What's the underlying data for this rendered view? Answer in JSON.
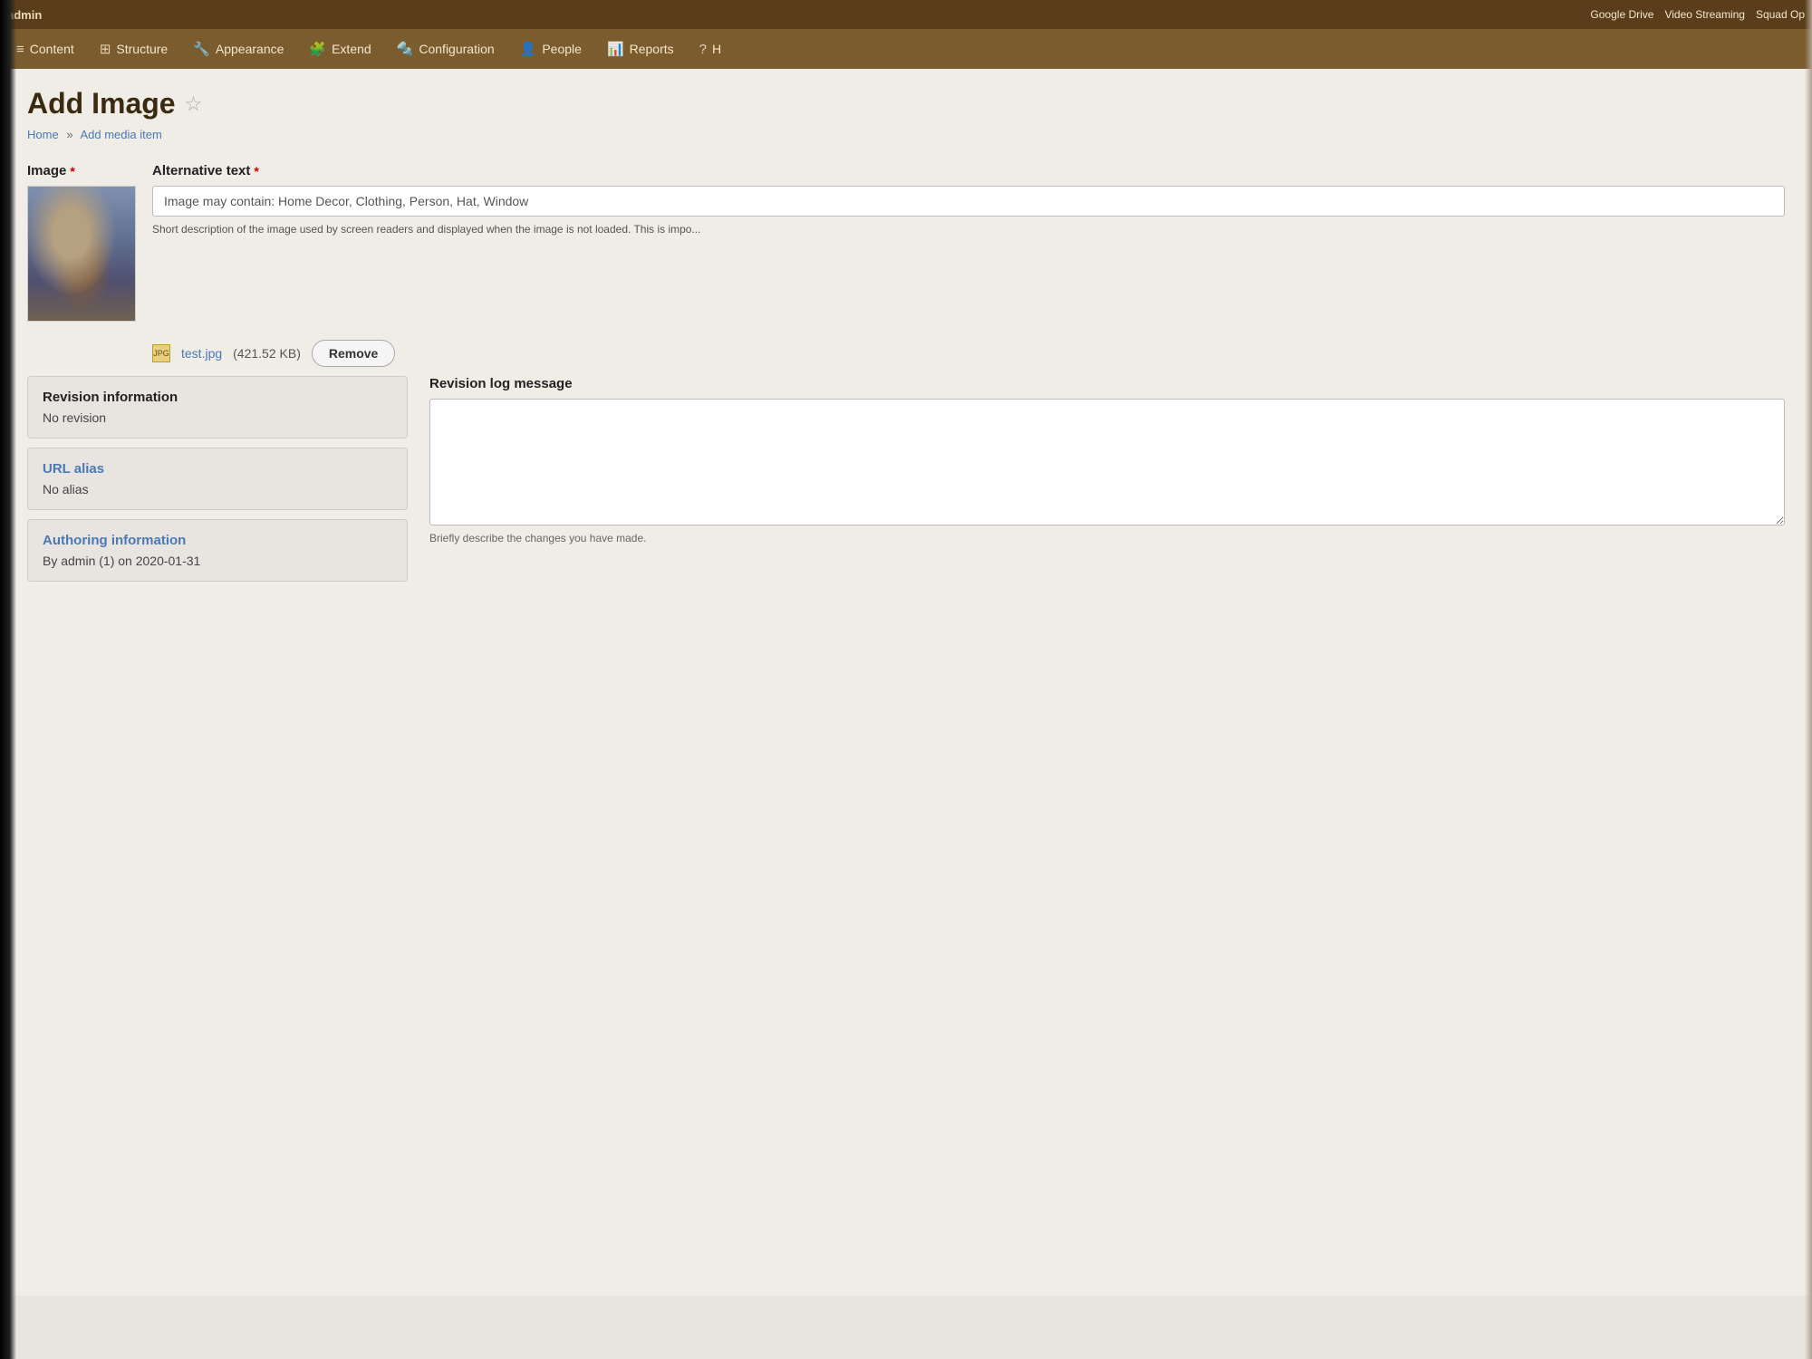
{
  "admin_bar": {
    "user_label": "admin",
    "google_drive": "Google Drive",
    "video_streaming": "Video Streaming",
    "squad_op": "Squad Op"
  },
  "nav": {
    "items": [
      {
        "id": "content",
        "label": "Content",
        "icon": "≡"
      },
      {
        "id": "structure",
        "label": "Structure",
        "icon": "⊞"
      },
      {
        "id": "appearance",
        "label": "Appearance",
        "icon": "🔧"
      },
      {
        "id": "extend",
        "label": "Extend",
        "icon": "🧩"
      },
      {
        "id": "configuration",
        "label": "Configuration",
        "icon": "🔩"
      },
      {
        "id": "people",
        "label": "People",
        "icon": "👤"
      },
      {
        "id": "reports",
        "label": "Reports",
        "icon": "📊"
      },
      {
        "id": "help",
        "label": "H",
        "icon": "?"
      }
    ]
  },
  "page": {
    "title": "Add Image",
    "breadcrumb_home": "Home",
    "breadcrumb_sep": "»",
    "breadcrumb_current": "Add media item"
  },
  "image_field": {
    "label": "Image",
    "required": true
  },
  "alt_text": {
    "label": "Alternative text",
    "required": true,
    "value": "Image may contain: Home Decor, Clothing, Person, Hat, Window",
    "hint": "Short description of the image used by screen readers and displayed when the image is not loaded. This is impo..."
  },
  "file_info": {
    "icon_label": "JPG",
    "filename": "test.jpg",
    "size": "(421.52 KB)",
    "remove_btn": "Remove"
  },
  "revision_info": {
    "box_title": "Revision information",
    "box_value": "No revision",
    "url_alias_title": "URL alias",
    "url_alias_value": "No alias",
    "authoring_title": "Authoring information",
    "authoring_value": "By admin (1) on 2020-01-31"
  },
  "revision_log": {
    "label": "Revision log message",
    "placeholder": "",
    "hint": "Briefly describe the changes you have made."
  }
}
